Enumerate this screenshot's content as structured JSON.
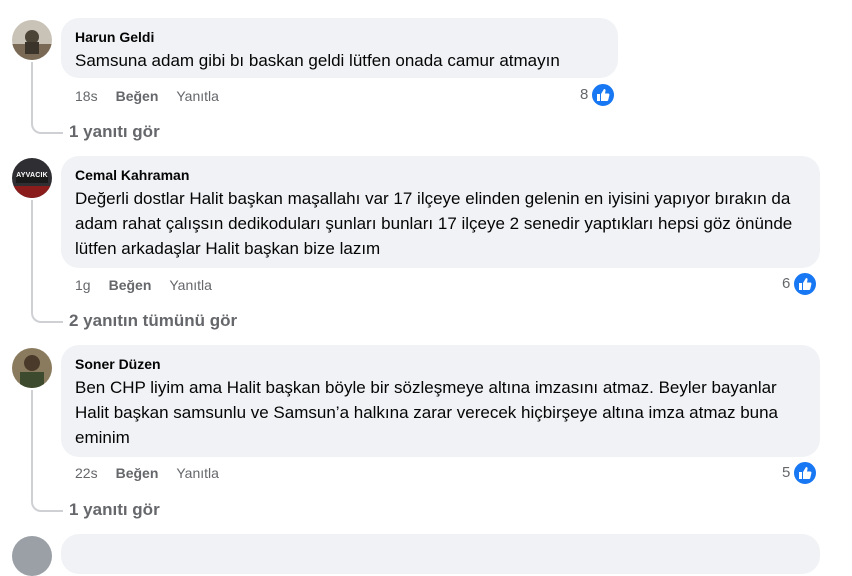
{
  "comments": [
    {
      "author": "Harun Geldi",
      "text": "Samsuna adam gibi bı baskan geldi lütfen onada camur atmayın",
      "time": "18s",
      "like_label": "Beğen",
      "reply_label": "Yanıtla",
      "reaction_count": "8",
      "replies_link": "1 yanıtı gör"
    },
    {
      "author": "Cemal Kahraman",
      "text": "Değerli dostlar Halit başkan maşallahı var 17 ilçeye elinden gelenin en iyisini yapıyor bırakın da adam rahat çalışsın dedikoduları şunları bunları 17 ilçeye 2 senedir yaptıkları hepsi göz önünde lütfen arkadaşlar Halit başkan bize lazım",
      "time": "1g",
      "like_label": "Beğen",
      "reply_label": "Yanıtla",
      "reaction_count": "6",
      "replies_link": "2 yanıtın tümünü gör",
      "avatar_text": "AYVACIK"
    },
    {
      "author": "Soner Düzen",
      "text": "Ben CHP liyim ama Halit başkan böyle bir sözleşmeye altına imzasını atmaz. Beyler bayanlar Halit başkan samsunlu ve Samsun’a halkına zarar verecek hiçbirşeye altına imza atmaz buna eminim",
      "time": "22s",
      "like_label": "Beğen",
      "reply_label": "Yanıtla",
      "reaction_count": "5",
      "replies_link": "1 yanıtı gör"
    }
  ],
  "colors": {
    "accent": "#1877f2",
    "bubble": "#f0f2f5",
    "meta": "#65676b",
    "line": "#ced0d4"
  },
  "icons": {
    "reaction": "like-thumb-icon"
  }
}
